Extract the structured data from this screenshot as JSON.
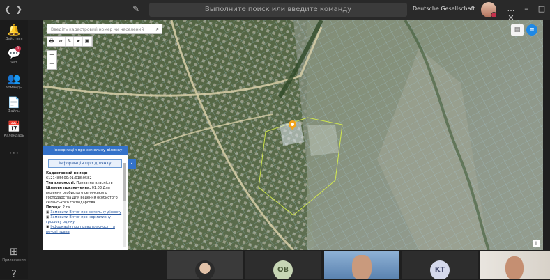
{
  "topbar": {
    "search_placeholder": "Выполните поиск или введите команду",
    "org_name": "Deutsche Gesellschaft ...",
    "window_controls": [
      "…",
      "–",
      "□",
      "✕"
    ]
  },
  "rail": [
    {
      "label": "Действия",
      "glyph": "🔔"
    },
    {
      "label": "Чат",
      "glyph": "💬",
      "badge": "1"
    },
    {
      "label": "Команды",
      "glyph": "👥"
    },
    {
      "label": "Файлы",
      "glyph": "📄"
    },
    {
      "label": "Календарь",
      "glyph": "📅"
    },
    {
      "label": "",
      "glyph": "⋯"
    },
    {
      "label": "Приложения",
      "glyph": "⊞"
    },
    {
      "label": "",
      "glyph": "?"
    }
  ],
  "map": {
    "search_placeholder": "Введіть кадастровий номер чи населений пункт",
    "zoom_in": "+",
    "zoom_out": "−",
    "tools": [
      "🖶",
      "⇔",
      "✎",
      "➤",
      "▣"
    ],
    "menu_glyph": "≡",
    "layers_glyph": "▤",
    "info_glyph": "i"
  },
  "panel": {
    "header": "Інформація про земельну ділянку",
    "tab": "Інформація про ділянку",
    "collapse_glyph": "‹",
    "cadastral_label": "Кадастровий номер:",
    "cadastral_value": "6121485600:01:018:0582",
    "ownership_label": "Тип власності:",
    "ownership_value": "Приватна власність",
    "purpose_label": "Цільове призначення:",
    "purpose_value": "01.03 Для ведення особистого селянського господарства Для ведення особистого селянського господарства",
    "area_label": "Площа:",
    "area_value": "2 га",
    "links": [
      "Замовити Витяг про земельну ділянку",
      "Замовити Витяг про нормативну грошову оцінку",
      "Інформація про право власності та речові права"
    ]
  },
  "participants": [
    {
      "initials": "",
      "kind": "video"
    },
    {
      "initials": "OB",
      "kind": "avatar",
      "color": "#c7d6b5"
    },
    {
      "initials": "",
      "kind": "video"
    },
    {
      "initials": "KT",
      "kind": "avatar",
      "color": "#d5d9ec"
    },
    {
      "initials": "",
      "kind": "video"
    }
  ]
}
